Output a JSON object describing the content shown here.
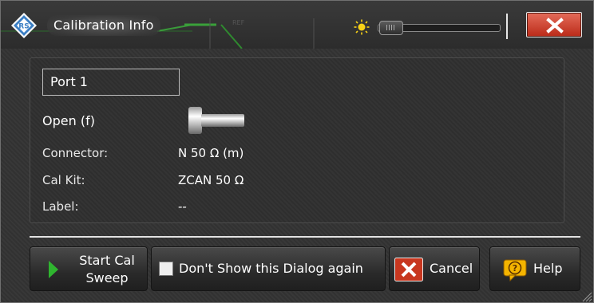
{
  "dialog": {
    "title": "Calibration Info",
    "title_icon": "rohde-schwarz-logo",
    "transparency_icon": "sun-icon",
    "transparency_level": 0.0,
    "close_icon": "close-icon"
  },
  "info": {
    "port": "Port 1",
    "standard": "Open (f)",
    "standard_icon": "open-standard-icon",
    "rows": [
      {
        "label": "Connector:",
        "value": "N 50 Ω (m)"
      },
      {
        "label": "Cal Kit:",
        "value": "ZCAN 50 Ω"
      },
      {
        "label": "Label:",
        "value": "--"
      }
    ]
  },
  "buttons": {
    "start_line1": "Start Cal",
    "start_line2": "Sweep",
    "dont_show": "Don't Show this Dialog again",
    "dont_show_checked": false,
    "cancel": "Cancel",
    "help": "Help"
  },
  "colors": {
    "background": "#333333",
    "close_red": "#c8371f",
    "play_green": "#2fb52f",
    "help_yellow": "#f4b400",
    "logo_blue": "#3c7fc4"
  }
}
